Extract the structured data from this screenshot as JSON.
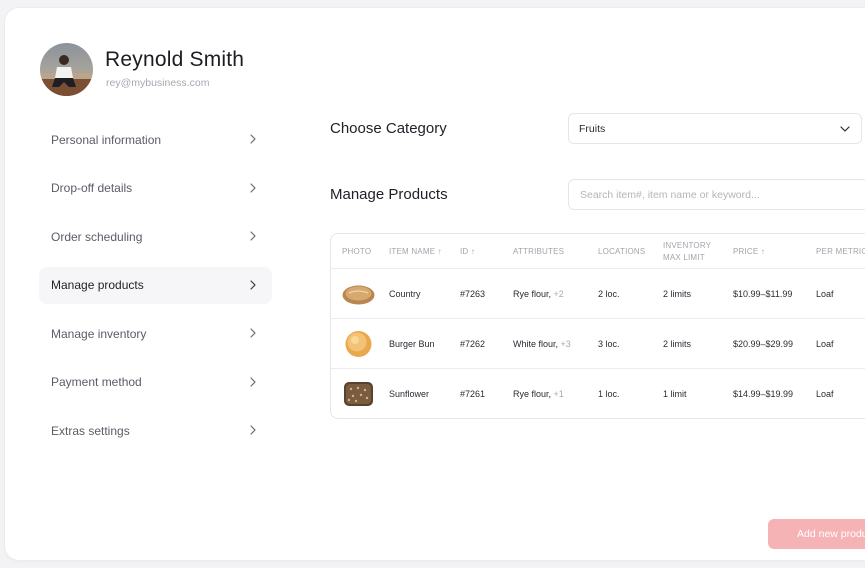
{
  "user": {
    "name": "Reynold Smith",
    "email": "rey@mybusiness.com"
  },
  "menu": {
    "items": [
      {
        "label": "Personal information"
      },
      {
        "label": "Drop-off details"
      },
      {
        "label": "Order scheduling"
      },
      {
        "label": "Manage products",
        "active": true
      },
      {
        "label": "Manage inventory"
      },
      {
        "label": "Payment method"
      },
      {
        "label": "Extras settings"
      }
    ]
  },
  "category": {
    "title": "Choose Category",
    "selected": "Fruits"
  },
  "products": {
    "title": "Manage Products",
    "search_placeholder": "Search item#, item name or keyword...",
    "columns": {
      "photo": "PHOTO",
      "item_name": "ITEM NAME ↑",
      "id": "ID ↑",
      "attributes": "ATTRIBUTES",
      "locations": "LOCATIONS",
      "inventory_line1": "INVENTORY",
      "inventory_line2": "MAX LIMIT",
      "price": "PRICE ↑",
      "per_metric": "PER METRIC"
    },
    "rows": [
      {
        "name": "Country",
        "id": "#7263",
        "attr": "Rye flour,",
        "attr_more": "+2",
        "locations": "2 loc.",
        "limit": "2 limits",
        "price": "$10.99–$11.99",
        "metric": "Loaf"
      },
      {
        "name": "Burger Bun",
        "id": "#7262",
        "attr": "White flour,",
        "attr_more": "+3",
        "locations": "3 loc.",
        "limit": "2 limits",
        "price": "$20.99–$29.99",
        "metric": "Loaf"
      },
      {
        "name": "Sunflower",
        "id": "#7261",
        "attr": "Rye flour,",
        "attr_more": "+1",
        "locations": "1 loc.",
        "limit": "1 limit",
        "price": "$14.99–$19.99",
        "metric": "Loaf"
      }
    ]
  },
  "actions": {
    "add_new": "Add new product"
  },
  "colors": {
    "accent": "#f6b3b5",
    "active_bg": "#f6f6f8"
  }
}
